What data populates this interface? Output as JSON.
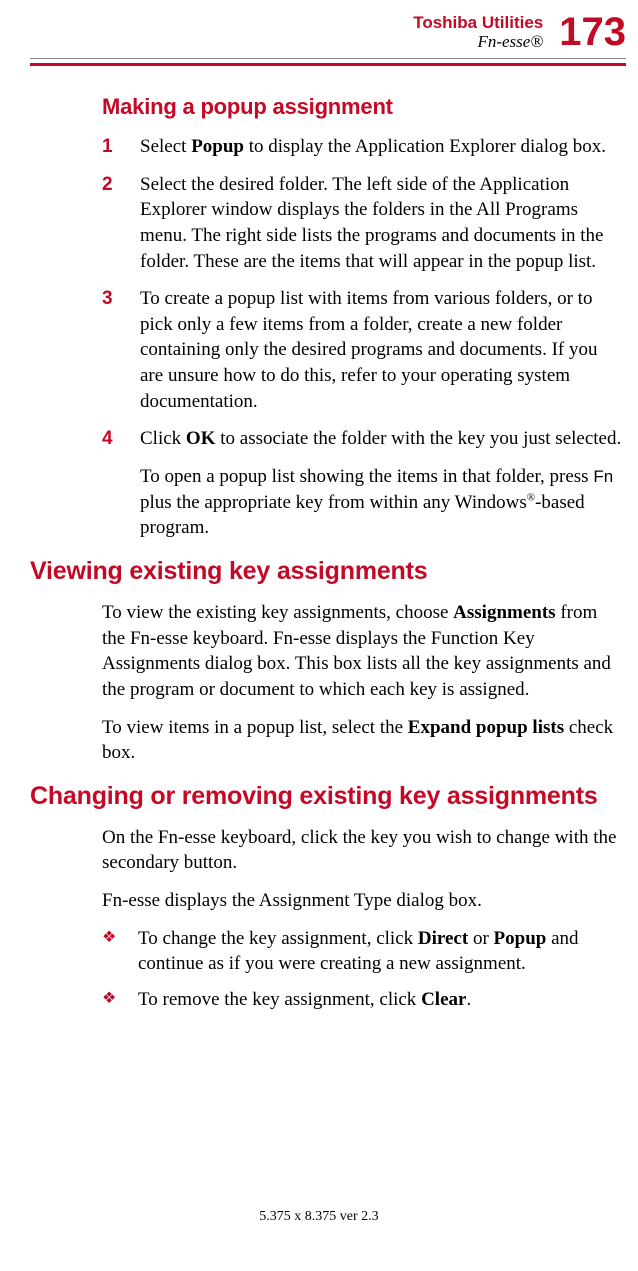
{
  "header": {
    "chapter": "Toshiba Utilities",
    "section": "Fn-esse®",
    "page_number": "173"
  },
  "h_making": "Making a popup assignment",
  "steps": [
    {
      "num": "1",
      "pre": "Select ",
      "bold": "Popup",
      "post": " to display the Application Explorer dialog box."
    },
    {
      "num": "2",
      "text": "Select the desired folder. The left side of the Application Explorer window displays the folders in the All Programs menu. The right side lists the programs and documents in the folder. These are the items that will appear in the popup list."
    },
    {
      "num": "3",
      "text": "To create a popup list with items from various folders, or to pick only a few items from a folder, create a new folder containing only the desired programs and documents. If you are unsure how to do this, refer to your operating system documentation."
    },
    {
      "num": "4",
      "pre": "Click ",
      "bold": "OK",
      "post": " to associate the folder with the key you just selected."
    }
  ],
  "post_step_para_pre": "To open a popup list showing the items in that folder, press ",
  "post_step_fn": "Fn",
  "post_step_mid": " plus the appropriate key from within any Windows",
  "post_step_sup": "®",
  "post_step_end": "-based program.",
  "h_viewing": "Viewing existing key assignments",
  "viewing_p1_pre": "To view the existing key assignments, choose ",
  "viewing_p1_bold": "Assignments",
  "viewing_p1_post": " from the Fn-esse keyboard. Fn-esse displays the Function Key Assignments dialog box. This box lists all the key assignments and the program or document to which each key is assigned.",
  "viewing_p2_pre": "To view items in a popup list, select the ",
  "viewing_p2_bold": "Expand popup lists",
  "viewing_p2_post": " check box.",
  "h_changing": "Changing or removing existing key assignments",
  "changing_p1": "On the Fn-esse keyboard, click the key you wish to change with the secondary button.",
  "changing_p2": "Fn-esse displays the Assignment Type dialog box.",
  "bullets": [
    {
      "pre": "To change the key assignment, click ",
      "b1": "Direct",
      "mid": " or ",
      "b2": "Popup",
      "post": " and continue as if you were creating a new assignment."
    },
    {
      "pre": "To remove the key assignment, click ",
      "b1": "Clear",
      "post": "."
    }
  ],
  "footer": "5.375 x 8.375 ver 2.3"
}
